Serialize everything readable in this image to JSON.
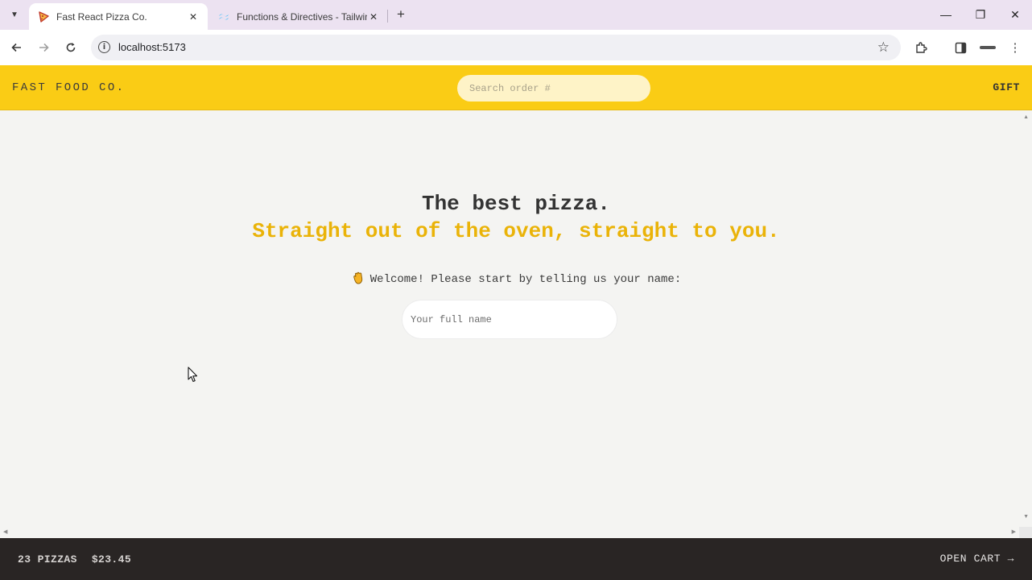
{
  "browser": {
    "tabs": [
      {
        "title": "Fast React Pizza Co.",
        "favicon": "pizza-favicon",
        "active": true
      },
      {
        "title": "Functions & Directives - Tailwind CSS",
        "favicon": "tailwind-favicon",
        "active": false
      }
    ],
    "new_tab_icon": "+",
    "url": "localhost:5173",
    "window_controls": {
      "minimize": "—",
      "restore": "❐",
      "close": "✕"
    }
  },
  "header": {
    "logo": "FAST FOOD CO.",
    "search_placeholder": "Search order #",
    "username": "GIFT"
  },
  "main": {
    "heading_line1": "The best pizza.",
    "heading_line2": "Straight out of the oven, straight to you.",
    "welcome_text": "Welcome! Please start by telling us your name:",
    "name_placeholder": "Your full name"
  },
  "cart": {
    "pizza_count": "23 PIZZAS",
    "total_price": "$23.45",
    "open_cart_label": "OPEN CART →"
  },
  "colors": {
    "header_bg": "#facc15",
    "search_bg": "#fef3c7",
    "accent_text": "#eab308",
    "cart_bg": "#292524",
    "page_bg": "#f4f4f2"
  }
}
